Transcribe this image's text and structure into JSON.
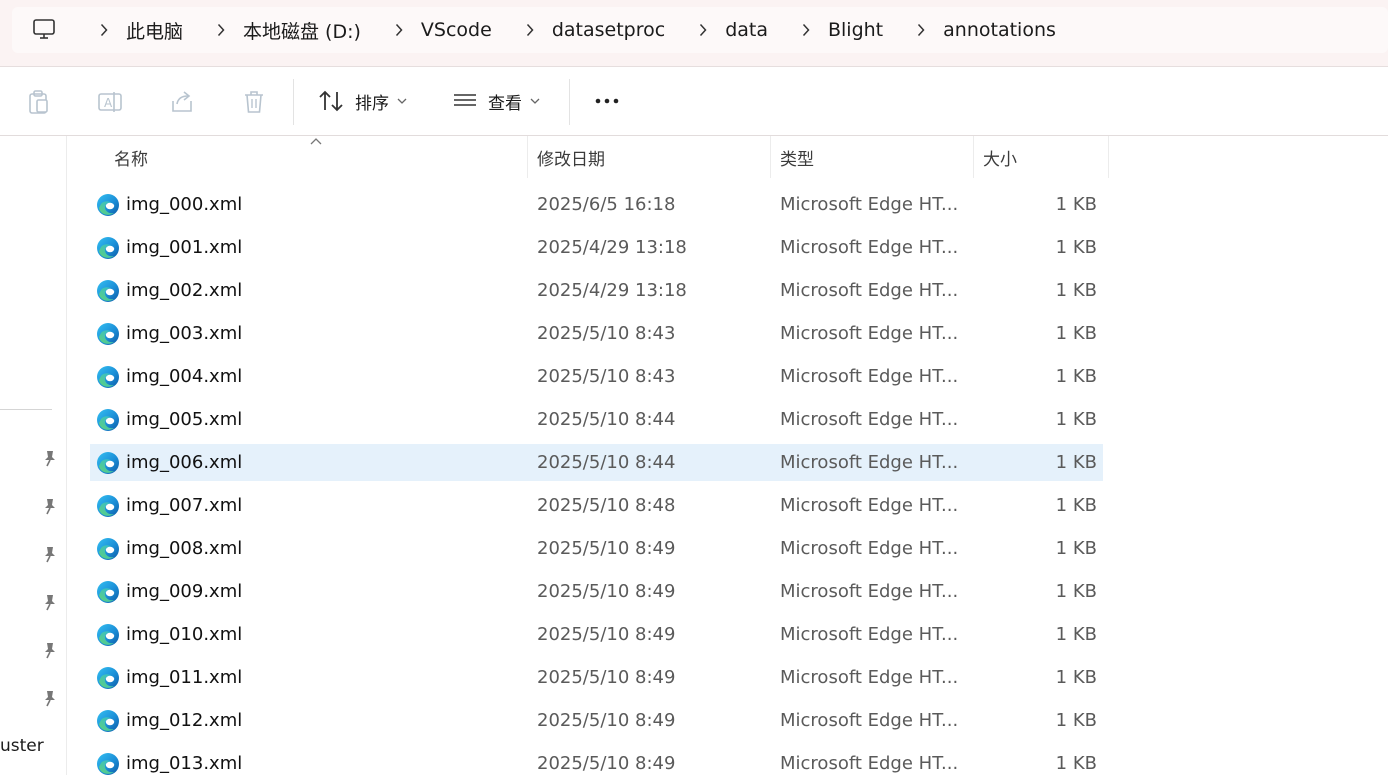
{
  "breadcrumb": {
    "items": [
      "此电脑",
      "本地磁盘 (D:)",
      "VScode",
      "datasetproc",
      "data",
      "Blight",
      "annotations"
    ]
  },
  "toolbar": {
    "sort_label": "排序",
    "view_label": "查看"
  },
  "nav": {
    "partial_item": "uster"
  },
  "columns": {
    "name": "名称",
    "date": "修改日期",
    "type": "类型",
    "size": "大小"
  },
  "files": [
    {
      "name": "img_000.xml",
      "date": "2025/6/5 16:18",
      "type": "Microsoft Edge HT...",
      "size": "1 KB"
    },
    {
      "name": "img_001.xml",
      "date": "2025/4/29 13:18",
      "type": "Microsoft Edge HT...",
      "size": "1 KB"
    },
    {
      "name": "img_002.xml",
      "date": "2025/4/29 13:18",
      "type": "Microsoft Edge HT...",
      "size": "1 KB"
    },
    {
      "name": "img_003.xml",
      "date": "2025/5/10 8:43",
      "type": "Microsoft Edge HT...",
      "size": "1 KB"
    },
    {
      "name": "img_004.xml",
      "date": "2025/5/10 8:43",
      "type": "Microsoft Edge HT...",
      "size": "1 KB"
    },
    {
      "name": "img_005.xml",
      "date": "2025/5/10 8:44",
      "type": "Microsoft Edge HT...",
      "size": "1 KB"
    },
    {
      "name": "img_006.xml",
      "date": "2025/5/10 8:44",
      "type": "Microsoft Edge HT...",
      "size": "1 KB",
      "selected": true
    },
    {
      "name": "img_007.xml",
      "date": "2025/5/10 8:48",
      "type": "Microsoft Edge HT...",
      "size": "1 KB"
    },
    {
      "name": "img_008.xml",
      "date": "2025/5/10 8:49",
      "type": "Microsoft Edge HT...",
      "size": "1 KB"
    },
    {
      "name": "img_009.xml",
      "date": "2025/5/10 8:49",
      "type": "Microsoft Edge HT...",
      "size": "1 KB"
    },
    {
      "name": "img_010.xml",
      "date": "2025/5/10 8:49",
      "type": "Microsoft Edge HT...",
      "size": "1 KB"
    },
    {
      "name": "img_011.xml",
      "date": "2025/5/10 8:49",
      "type": "Microsoft Edge HT...",
      "size": "1 KB"
    },
    {
      "name": "img_012.xml",
      "date": "2025/5/10 8:49",
      "type": "Microsoft Edge HT...",
      "size": "1 KB"
    },
    {
      "name": "img_013.xml",
      "date": "2025/5/10 8:49",
      "type": "Microsoft Edge HT...",
      "size": "1 KB"
    }
  ],
  "colors": {
    "selected_row": "#e5f1fb",
    "topbar_bg": "#fbf3f3"
  },
  "icons": {
    "location": "monitor-icon",
    "file": "edge-icon",
    "pin": "pin-icon"
  }
}
